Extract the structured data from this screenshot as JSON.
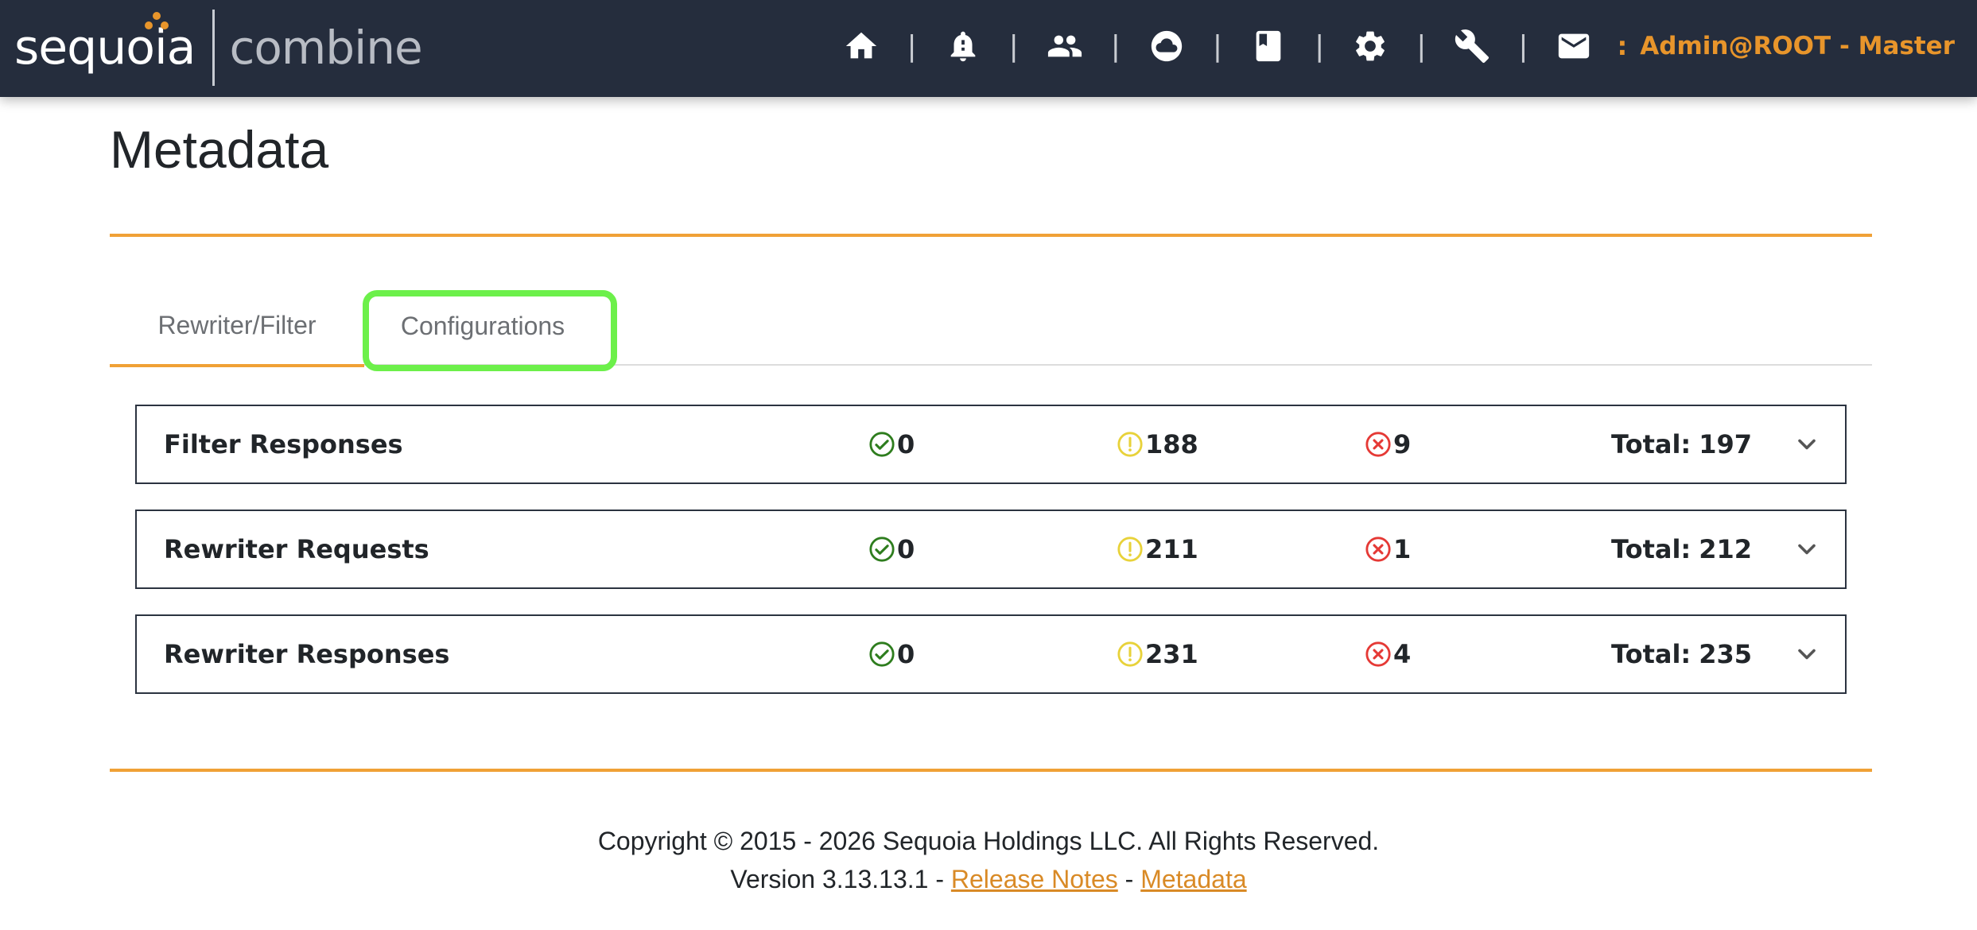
{
  "header": {
    "logo_text": "sequoia",
    "logo_sub": "combine",
    "nav_icons": [
      "home-icon",
      "bell-icon",
      "users-icon",
      "cloud-icon",
      "book-icon",
      "gear-icon",
      "wrench-icon",
      "mail-icon"
    ],
    "separator": "|",
    "colon": ":",
    "user": "Admin@ROOT - Master",
    "accent_color": "#e8952b",
    "bar_color": "#252d3d"
  },
  "page": {
    "title": "Metadata"
  },
  "tabs": [
    {
      "label": "Rewriter/Filter",
      "active": true
    },
    {
      "label": "Configurations",
      "active": false,
      "highlighted": true
    }
  ],
  "rows": [
    {
      "title": "Filter Responses",
      "ok": "0",
      "warn": "188",
      "err": "9",
      "total_label": "Total:",
      "total": "197"
    },
    {
      "title": "Rewriter Requests",
      "ok": "0",
      "warn": "211",
      "err": "1",
      "total_label": "Total:",
      "total": "212"
    },
    {
      "title": "Rewriter Responses",
      "ok": "0",
      "warn": "231",
      "err": "4",
      "total_label": "Total:",
      "total": "235"
    }
  ],
  "status_colors": {
    "ok": "#2e7d1e",
    "warn": "#e8d23a",
    "err": "#e53935"
  },
  "footer": {
    "copyright": "Copyright © 2015 - 2026 Sequoia Holdings LLC. All Rights Reserved.",
    "version_prefix": "Version 3.13.13.1 -",
    "release_notes": "Release Notes",
    "dash": "-",
    "metadata_link": "Metadata"
  }
}
